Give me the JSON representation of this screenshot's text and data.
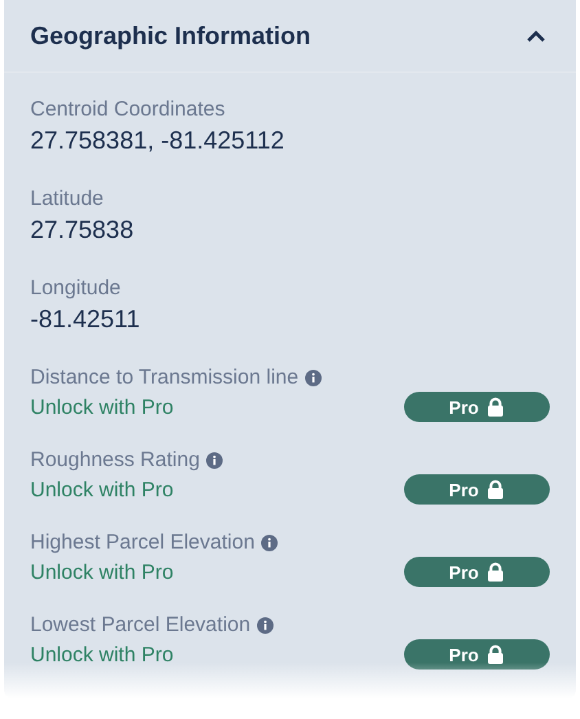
{
  "panel": {
    "title": "Geographic Information",
    "expanded": true
  },
  "fields": [
    {
      "kind": "value",
      "label": "Centroid Coordinates",
      "value": "27.758381, -81.425112"
    },
    {
      "kind": "value",
      "label": "Latitude",
      "value": "27.75838"
    },
    {
      "kind": "value",
      "label": "Longitude",
      "value": "-81.42511"
    },
    {
      "kind": "locked",
      "label": "Distance to Transmission line",
      "value": "Unlock with Pro",
      "badge": "Pro"
    },
    {
      "kind": "locked",
      "label": "Roughness Rating",
      "value": "Unlock with Pro",
      "badge": "Pro"
    },
    {
      "kind": "locked",
      "label": "Highest Parcel Elevation",
      "value": "Unlock with Pro",
      "badge": "Pro"
    },
    {
      "kind": "locked",
      "label": "Lowest Parcel Elevation",
      "value": "Unlock with Pro",
      "badge": "Pro"
    }
  ]
}
